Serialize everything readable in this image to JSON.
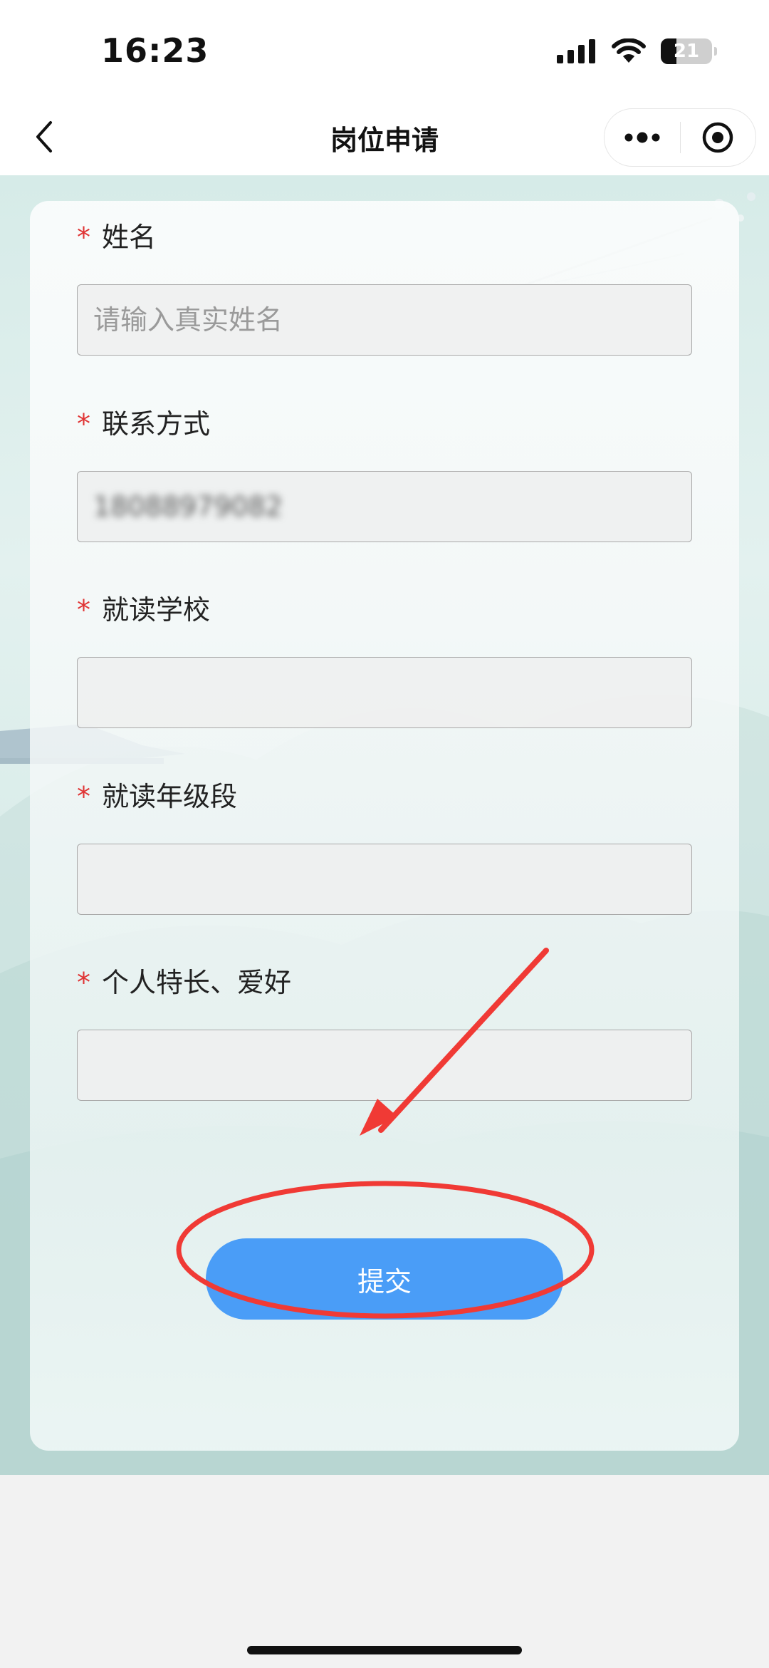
{
  "status_bar": {
    "time": "16:23",
    "battery_level": "21",
    "icons": [
      "signal-icon",
      "wifi-icon",
      "battery-icon"
    ]
  },
  "nav": {
    "title": "岗位申请",
    "back_icon": "chevron-left-icon",
    "more_icon": "more-dots-icon",
    "close_icon": "target-circle-icon"
  },
  "form": {
    "required_mark": "*",
    "fields": [
      {
        "label": "姓名",
        "placeholder": "请输入真实姓名",
        "value": ""
      },
      {
        "label": "联系方式",
        "placeholder": "",
        "value": "18088979082"
      },
      {
        "label": "就读学校",
        "placeholder": "",
        "value": ""
      },
      {
        "label": "就读年级段",
        "placeholder": "",
        "value": ""
      },
      {
        "label": "个人特长、爱好",
        "placeholder": "",
        "value": ""
      }
    ],
    "submit_label": "提交"
  },
  "colors": {
    "accent": "#4a9df7",
    "required": "#e03434",
    "annotation": "#f03a35"
  }
}
